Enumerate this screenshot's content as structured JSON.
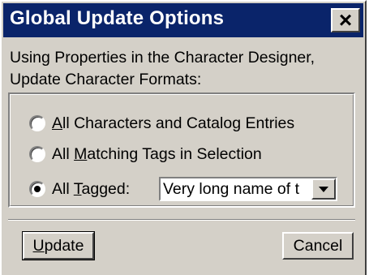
{
  "window": {
    "title": "Global Update Options",
    "close_label": "×"
  },
  "message": {
    "line1": "Using Properties in the Character Designer,",
    "line2": "Update Character Formats:"
  },
  "options": [
    {
      "accel": "A",
      "rest": "ll Characters and Catalog Entries",
      "checked": false
    },
    {
      "pre": "All ",
      "accel": "M",
      "rest": "atching Tags in Selection",
      "checked": false
    },
    {
      "pre": "All ",
      "accel": "T",
      "rest": "agged:",
      "checked": true
    }
  ],
  "tag_combo": {
    "value": "Very long name of t",
    "icon": "dropdown-arrow-icon"
  },
  "buttons": {
    "update_accel": "U",
    "update_rest": "pdate",
    "cancel": "Cancel"
  },
  "colors": {
    "titlebar": "#0a246a",
    "face": "#d4d0c8"
  }
}
